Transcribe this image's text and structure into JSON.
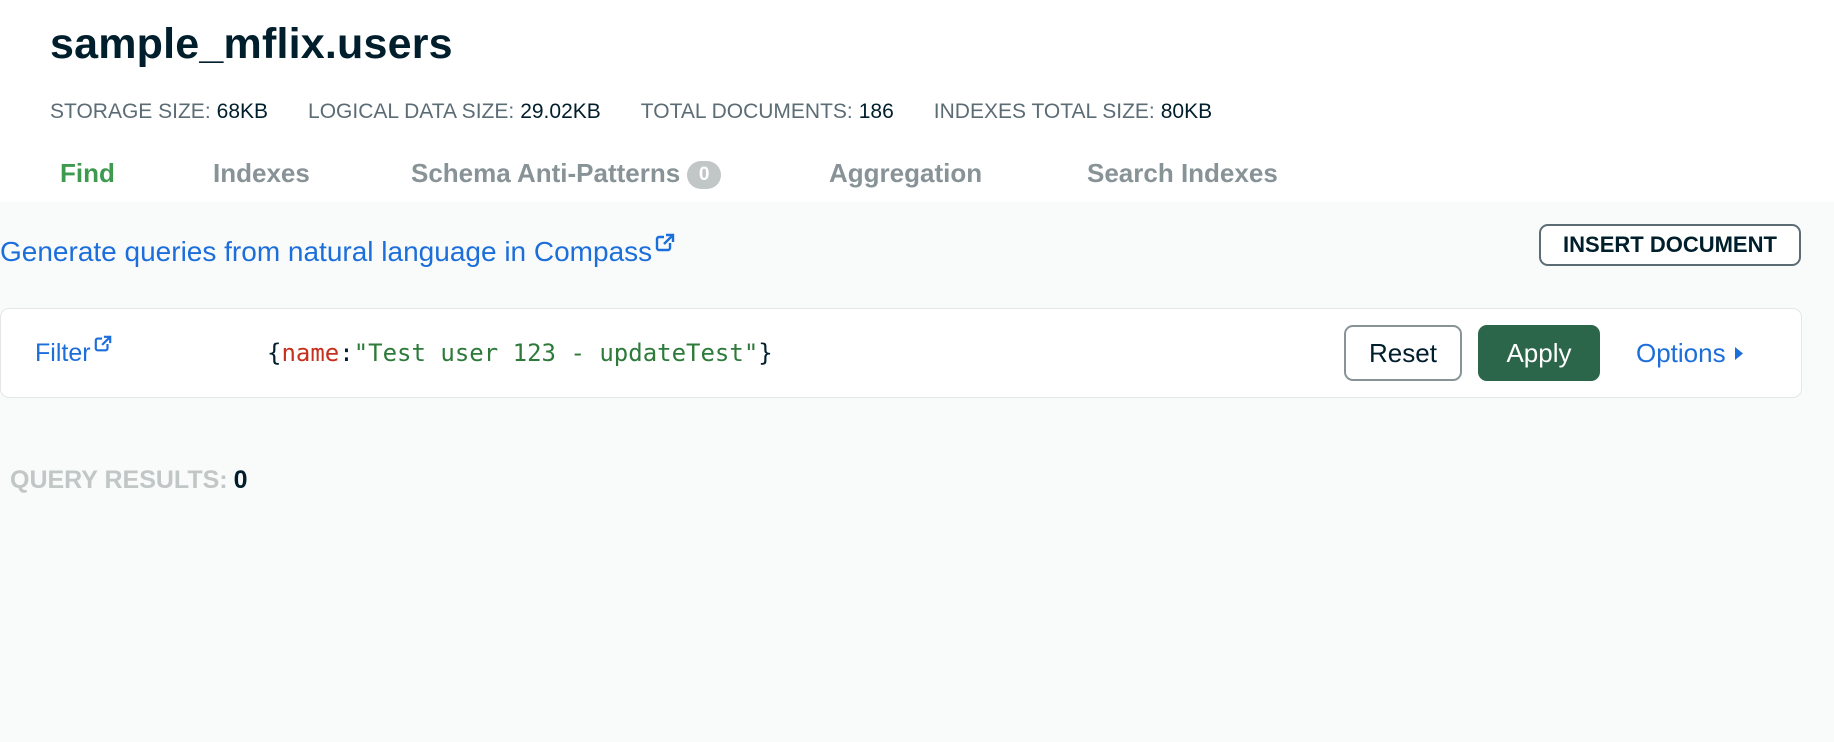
{
  "collection": {
    "title": "sample_mflix.users"
  },
  "stats": [
    {
      "label": "STORAGE SIZE:",
      "value": "68KB"
    },
    {
      "label": "LOGICAL DATA SIZE:",
      "value": "29.02KB"
    },
    {
      "label": "TOTAL DOCUMENTS:",
      "value": "186"
    },
    {
      "label": "INDEXES TOTAL SIZE:",
      "value": "80KB"
    }
  ],
  "tabs": [
    {
      "label": "Find",
      "active": true
    },
    {
      "label": "Indexes"
    },
    {
      "label": "Schema Anti-Patterns",
      "badge": "0"
    },
    {
      "label": "Aggregation"
    },
    {
      "label": "Search Indexes"
    }
  ],
  "toolbar": {
    "generate_link": "Generate queries from natural language in Compass",
    "insert_label": "INSERT DOCUMENT"
  },
  "filter": {
    "label": "Filter",
    "query_open": "{",
    "query_key": "name",
    "query_colon": ":",
    "query_value": "\"Test user 123 - updateTest\"",
    "query_close": "}",
    "reset_label": "Reset",
    "apply_label": "Apply",
    "options_label": "Options"
  },
  "results": {
    "label": "QUERY RESULTS:",
    "count": "0"
  },
  "colors": {
    "accent_green": "#3d9a4f",
    "apply_button": "#2b654a",
    "link_blue": "#1c6edb",
    "query_key": "#c5301f",
    "query_string": "#2d7a3a"
  },
  "icons": [
    "external-link-icon",
    "caret-right-icon"
  ]
}
